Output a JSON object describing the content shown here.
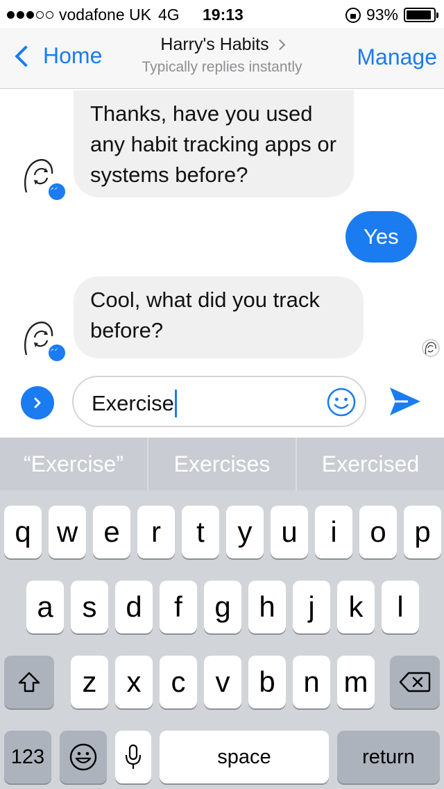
{
  "status_bar": {
    "carrier": "vodafone UK",
    "network": "4G",
    "time": "19:13",
    "battery_percent": "93%",
    "battery_level": 0.93,
    "signal_bars_filled": 3,
    "signal_bars_total": 5
  },
  "nav": {
    "back_label": "Home",
    "title": "Harry's Habits",
    "subtitle": "Typically replies instantly",
    "manage_label": "Manage"
  },
  "messages": [
    {
      "from": "bot",
      "text": "Thanks, have you used any habit tracking apps or systems before?"
    },
    {
      "from": "user",
      "text": "Yes"
    },
    {
      "from": "bot",
      "text": "Cool, what did you track before?"
    }
  ],
  "composer": {
    "value": "Exercise"
  },
  "keyboard": {
    "predictions": [
      "“Exercise”",
      "Exercises",
      "Exercised"
    ],
    "row1": [
      "q",
      "w",
      "e",
      "r",
      "t",
      "y",
      "u",
      "i",
      "o",
      "p"
    ],
    "row2": [
      "a",
      "s",
      "d",
      "f",
      "g",
      "h",
      "j",
      "k",
      "l"
    ],
    "row3": [
      "z",
      "x",
      "c",
      "v",
      "b",
      "n",
      "m"
    ],
    "numbers_label": "123",
    "space_label": "space",
    "return_label": "return"
  },
  "colors": {
    "accent": "#1a7cf0",
    "bubble_in": "#f0f0f0",
    "keyboard_bg": "#d1d4d9"
  }
}
